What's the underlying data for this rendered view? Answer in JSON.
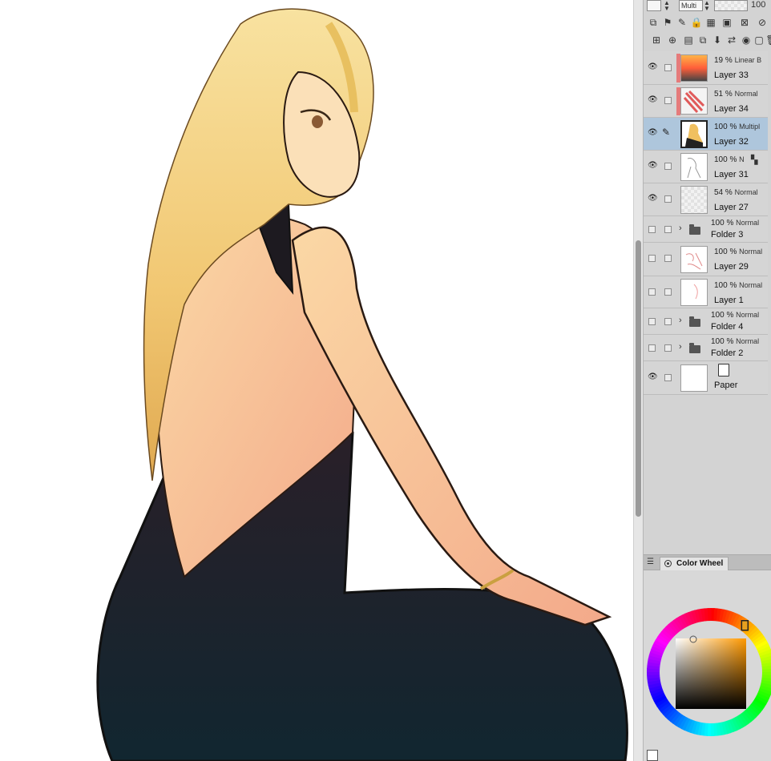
{
  "colors": {
    "panel_bg": "#d3d3d3",
    "selected_row": "#aec6dc",
    "layer_color_tag": "#e57b7b",
    "selected_hue": "#e6a020"
  },
  "toolbar": {
    "blend_mode_short": "Multi",
    "opacity_value": "100"
  },
  "layers": [
    {
      "opacity": "19 %",
      "blend": "Linear B",
      "name": "Layer 33",
      "visible": true,
      "selected": false,
      "tag": true
    },
    {
      "opacity": "51 %",
      "blend": "Normal",
      "name": "Layer 34",
      "visible": true,
      "selected": false,
      "tag": true
    },
    {
      "opacity": "100 %",
      "blend": "Multipl",
      "name": "Layer 32",
      "visible": true,
      "selected": true,
      "tag": false
    },
    {
      "opacity": "100 %",
      "blend": "N",
      "name": "Layer 31",
      "visible": true,
      "selected": false,
      "tag": false
    },
    {
      "opacity": "54 %",
      "blend": "Normal",
      "name": "Layer 27",
      "visible": true,
      "selected": false,
      "tag": false
    },
    {
      "opacity": "100 %",
      "blend": "Normal",
      "name": "Folder 3",
      "visible": false,
      "folder": true
    },
    {
      "opacity": "100 %",
      "blend": "Normal",
      "name": "Layer 29",
      "visible": false,
      "selected": false,
      "tag": false
    },
    {
      "opacity": "100 %",
      "blend": "Normal",
      "name": "Layer 1",
      "visible": false,
      "selected": false,
      "tag": false
    },
    {
      "opacity": "100 %",
      "blend": "Normal",
      "name": "Folder 4",
      "visible": false,
      "folder": true
    },
    {
      "opacity": "100 %",
      "blend": "Normal",
      "name": "Folder 2",
      "visible": false,
      "folder": true
    },
    {
      "opacity": "",
      "blend": "",
      "name": "Paper",
      "visible": true,
      "paper": true
    }
  ],
  "color_panel": {
    "tab_label": "Color Wheel",
    "hue_degrees": 36
  },
  "icons": {
    "eye": "eye-icon",
    "pen": "pen-icon",
    "folder": "folder-icon",
    "expand": "chevron-right-icon",
    "reference": "reference-layer-icon",
    "paper": "paper-icon"
  }
}
